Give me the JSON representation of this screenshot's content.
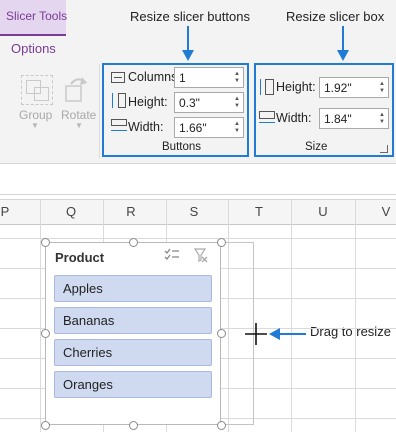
{
  "ribbon": {
    "tool_tab": "Slicer Tools",
    "active_tab": "Options",
    "arrange": {
      "group_label": "Group",
      "rotate_label": "Rotate"
    },
    "buttons_group": {
      "footer": "Buttons",
      "columns_label": "Columns:",
      "columns_value": "1",
      "height_label": "Height:",
      "height_value": "0.3\"",
      "width_label": "Width:",
      "width_value": "1.66\""
    },
    "size_group": {
      "footer": "Size",
      "height_label": "Height:",
      "height_value": "1.92\"",
      "width_label": "Width:",
      "width_value": "1.84\""
    }
  },
  "annotations": {
    "buttons": "Resize slicer buttons",
    "size": "Resize slicer box",
    "drag": "Drag to resize",
    "color": "#1f7bd3"
  },
  "sheet": {
    "columns": [
      "P",
      "Q",
      "R",
      "S",
      "T",
      "U",
      "V"
    ]
  },
  "slicer": {
    "title": "Product",
    "icons": [
      "multi-select-icon",
      "clear-filter-icon"
    ],
    "items": [
      "Apples",
      "Bananas",
      "Cherries",
      "Oranges"
    ],
    "item_color": "#cfdaf1"
  }
}
